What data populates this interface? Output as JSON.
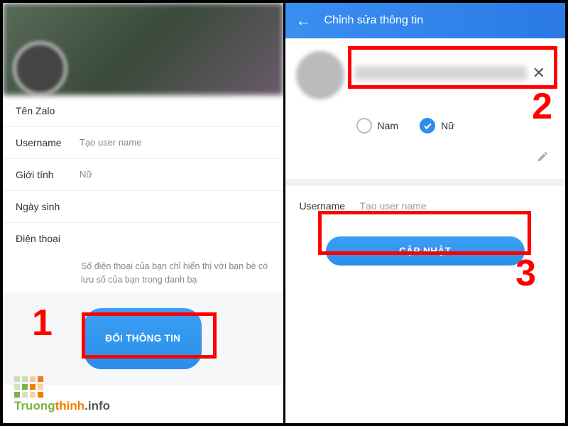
{
  "left": {
    "fields": {
      "name_label": "Tên Zalo",
      "username_label": "Username",
      "username_placeholder": "Tạo user name",
      "gender_label": "Giới tính",
      "gender_value": "Nữ",
      "birthday_label": "Ngày sinh",
      "phone_label": "Điện thoại"
    },
    "phone_note": "Số điện thoại của bạn chỉ hiển thị với bạn bè có lưu số của bạn trong danh bạ",
    "change_button": "ĐỔI THÔNG TIN"
  },
  "right": {
    "header_title": "Chỉnh sửa thông tin",
    "gender": {
      "male": "Nam",
      "female": "Nữ",
      "selected": "female"
    },
    "username_label": "Username",
    "username_placeholder": "Tạo user name",
    "update_button": "CẬP NHẬT"
  },
  "annotations": {
    "n1": "1",
    "n2": "2",
    "n3": "3"
  },
  "watermark": {
    "part1": "Truong",
    "part2": "thinh",
    "part3": ".info"
  }
}
